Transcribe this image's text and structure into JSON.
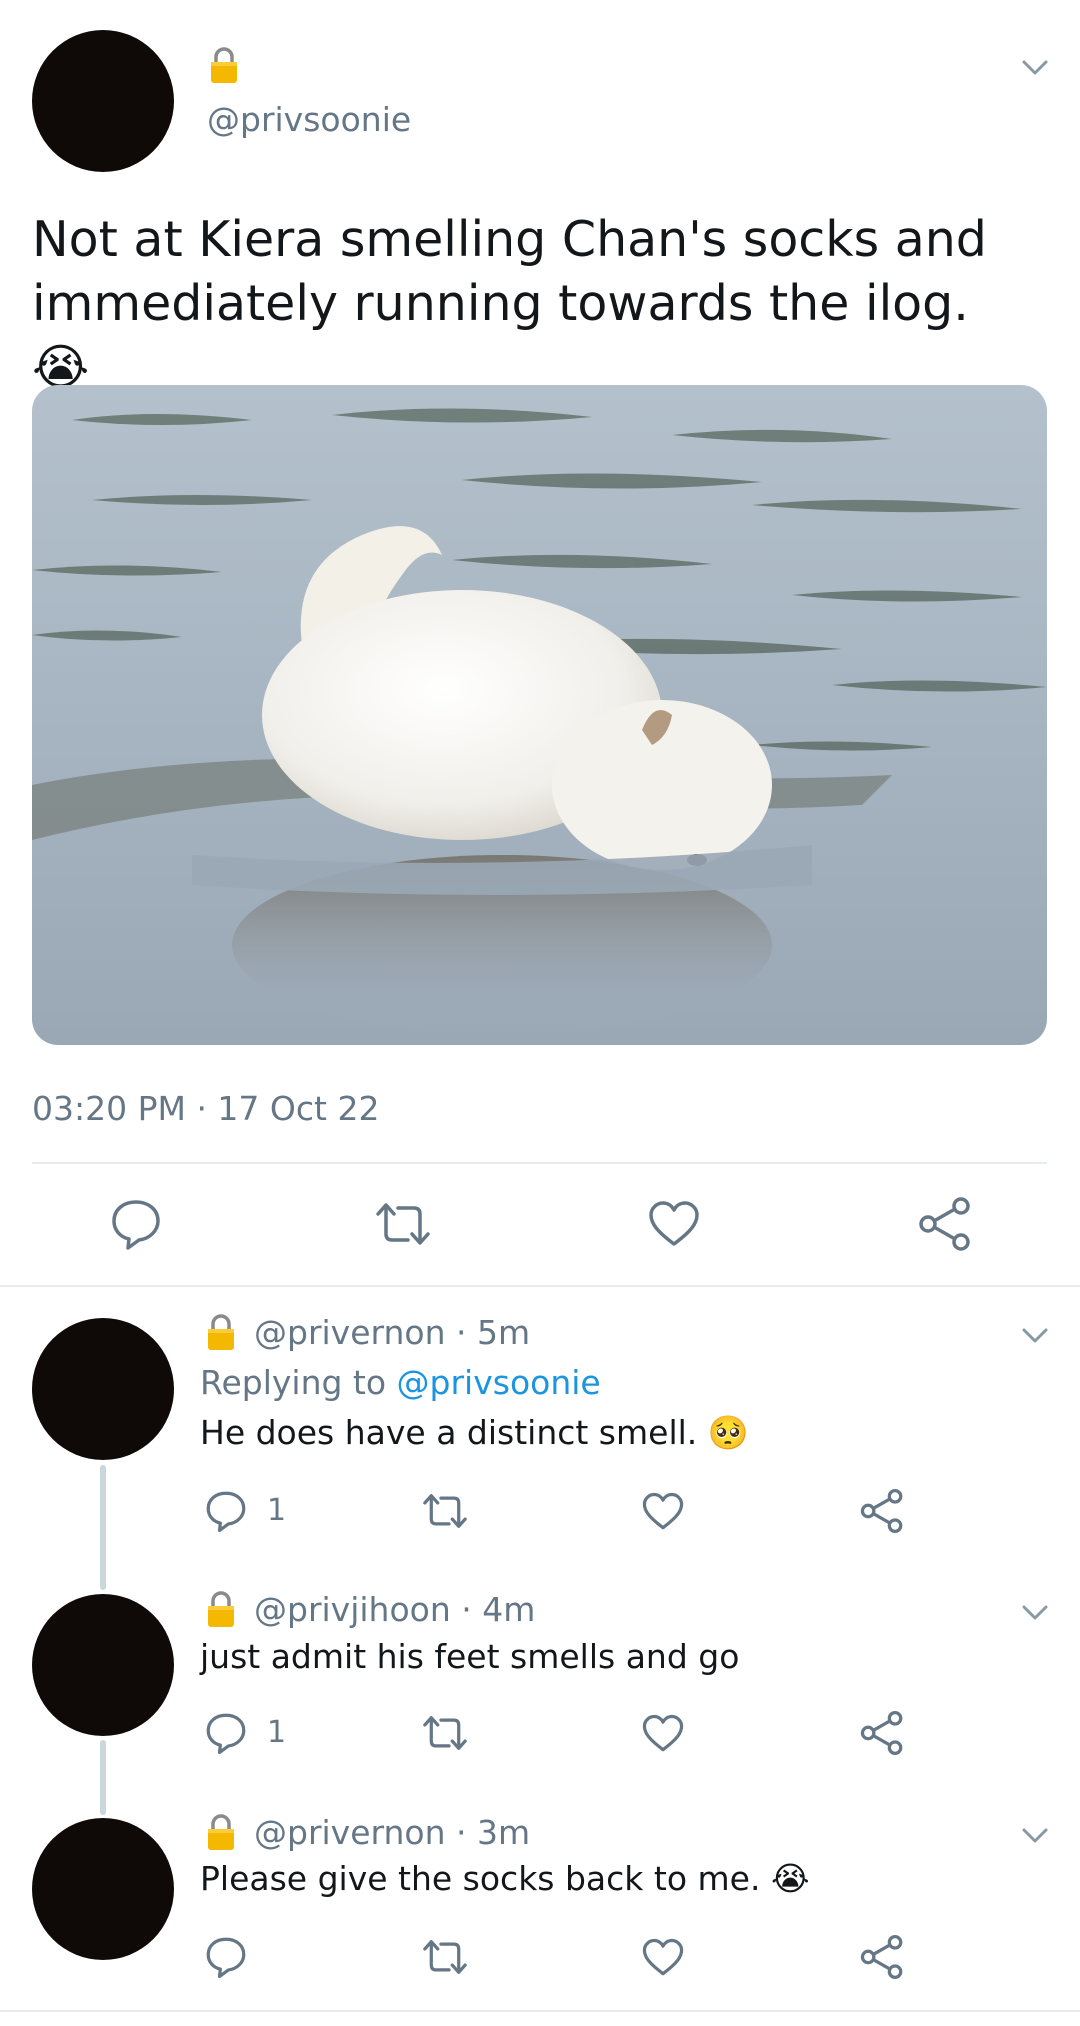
{
  "main_tweet": {
    "handle": "@privsoonie",
    "text": "Not at Kiera smelling Chan's socks and immediately running towards the ilog.",
    "emoji": "😭",
    "timestamp": "03:20 PM · 17 Oct 22",
    "image_alt": "white fluffy dog wading in water"
  },
  "replies": [
    {
      "handle": "@privernon",
      "time": "· 5m",
      "replying_prefix": "Replying to",
      "replying_to": "@privsoonie",
      "text": "He does have a distinct smell.",
      "emoji": "🥺",
      "reply_count": "1"
    },
    {
      "handle": "@privjihoon",
      "time": "· 4m",
      "text": "just admit his feet smells and go",
      "reply_count": "1"
    },
    {
      "handle": "@privernon",
      "time": "· 3m",
      "text": "Please give the socks back to me.",
      "emoji": "😭",
      "reply_count": ""
    }
  ],
  "colors": {
    "text": "#14171a",
    "muted": "#657786",
    "link": "#1b95e0",
    "lock": "#f5b800",
    "divider": "#e6ecf0"
  },
  "icons": [
    "lock-icon",
    "chevron-down-icon",
    "reply-icon",
    "retweet-icon",
    "like-icon",
    "share-icon"
  ]
}
